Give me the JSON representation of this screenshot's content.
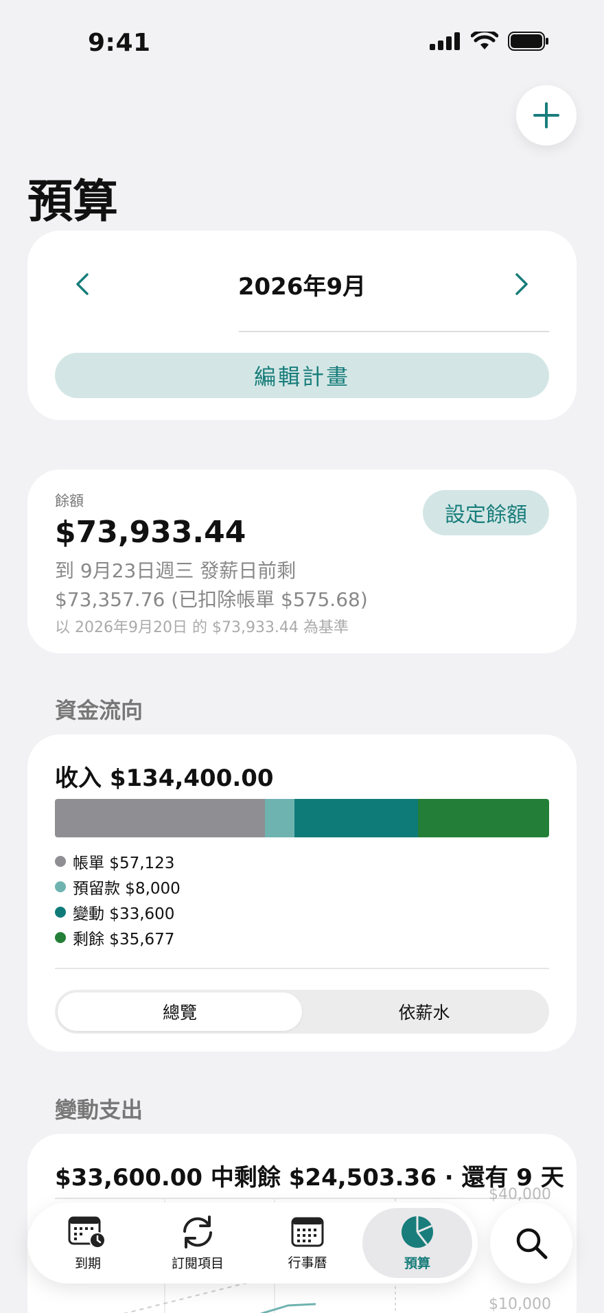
{
  "status_bar": {
    "time": "9:41"
  },
  "page": {
    "title": "預算"
  },
  "month_nav": {
    "label": "2026年9月",
    "edit_label": "編輯計畫"
  },
  "balance": {
    "label": "餘額",
    "amount": "$73,933.44",
    "line1": "到 9月23日週三 發薪日前剩",
    "line2": "$73,357.76 (已扣除帳單 $575.68)",
    "note": "以 2026年9月20日 的 $73,933.44 為基準",
    "set_label": "設定餘額"
  },
  "cash_flow": {
    "section_title": "資金流向",
    "income": "收入 $134,400.00",
    "segments": [
      {
        "label": "帳單 $57,123",
        "value": 57123,
        "color": "#8e8e93"
      },
      {
        "label": "預留款 $8,000",
        "value": 8000,
        "color": "#6fb3b0"
      },
      {
        "label": "變動 $33,600",
        "value": 33600,
        "color": "#0f7b79"
      },
      {
        "label": "剩餘 $35,677",
        "value": 35677,
        "color": "#237e37"
      }
    ],
    "tabs": [
      "總覽",
      "依薪水"
    ]
  },
  "variable": {
    "section_title": "變動支出",
    "summary": "$33,600.00 中剩餘 $24,503.36 · 還有 9 天",
    "axis": [
      "$40,000",
      "$10,000"
    ]
  },
  "tabbar": {
    "items": [
      {
        "label": "到期",
        "icon": "calendar-clock-icon"
      },
      {
        "label": "訂閱項目",
        "icon": "refresh-icon"
      },
      {
        "label": "行事曆",
        "icon": "calendar-icon"
      },
      {
        "label": "預算",
        "icon": "pie-chart-icon"
      }
    ],
    "search_icon": "search-icon"
  },
  "colors": {
    "accent": "#187d7b",
    "accent_soft": "#d3e6e5",
    "background": "#f2f2f4"
  }
}
